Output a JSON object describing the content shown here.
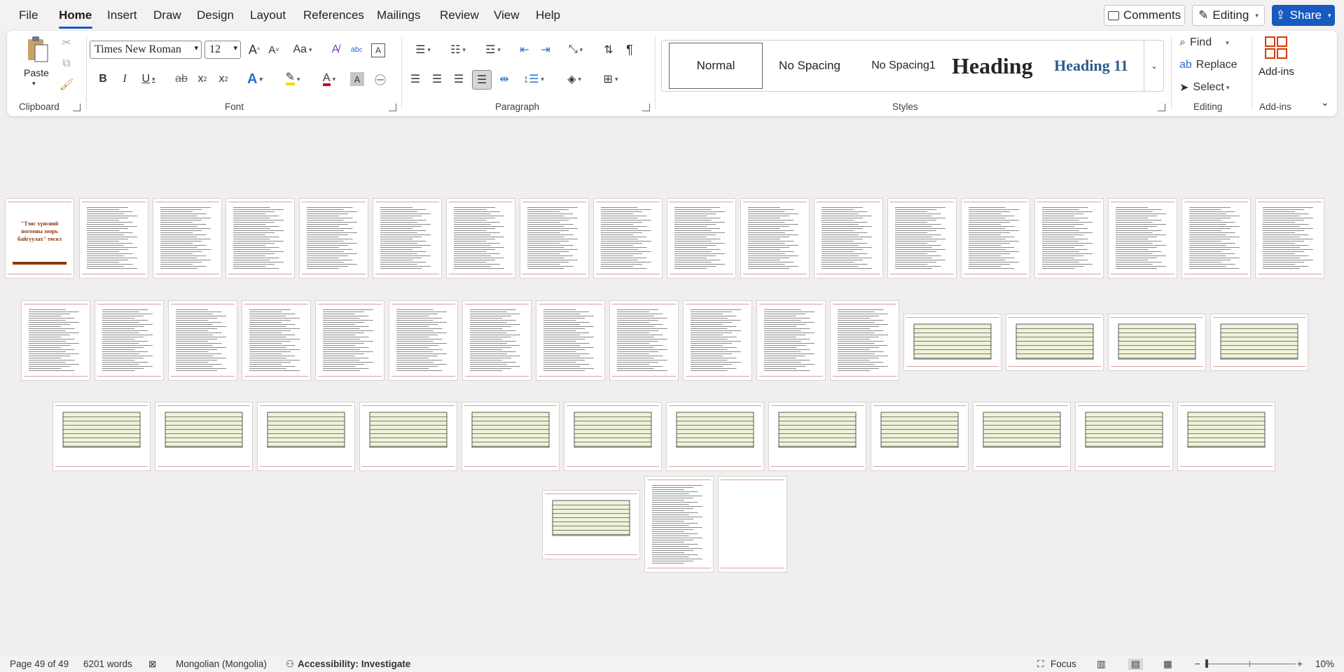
{
  "menu": {
    "tabs": [
      "File",
      "Home",
      "Insert",
      "Draw",
      "Design",
      "Layout",
      "References",
      "Mailings",
      "Review",
      "View",
      "Help"
    ],
    "active": "Home"
  },
  "actions": {
    "comments": "Comments",
    "editing": "Editing",
    "share": "Share"
  },
  "ribbon": {
    "clipboard": {
      "label": "Clipboard",
      "paste": "Paste"
    },
    "font": {
      "label": "Font",
      "family": "Times New Roman",
      "size": "12",
      "aa": "Aa"
    },
    "paragraph": {
      "label": "Paragraph"
    },
    "styles": {
      "label": "Styles",
      "items": [
        "Normal",
        "No Spacing",
        "No Spacing1",
        "Heading",
        "Heading 11"
      ]
    },
    "editing": {
      "label": "Editing",
      "find": "Find",
      "replace": "Replace",
      "select": "Select"
    },
    "addins": {
      "label": "Add-ins",
      "button": "Add-ins"
    }
  },
  "document": {
    "cover_title": "\"Тэнс хүнсний ногооны зоорь байгуулах\" төсөл",
    "page_count": 49
  },
  "status": {
    "page": "Page 49 of 49",
    "words": "6201 words",
    "language": "Mongolian (Mongolia)",
    "accessibility": "Accessibility: Investigate",
    "focus": "Focus",
    "zoom": "10%"
  },
  "colors": {
    "accent": "#185abd",
    "page_rule": "#d9a0a0",
    "heading_blue": "#2e5a8c",
    "font_red": "#c50f1f",
    "highlight": "#ffd400"
  }
}
